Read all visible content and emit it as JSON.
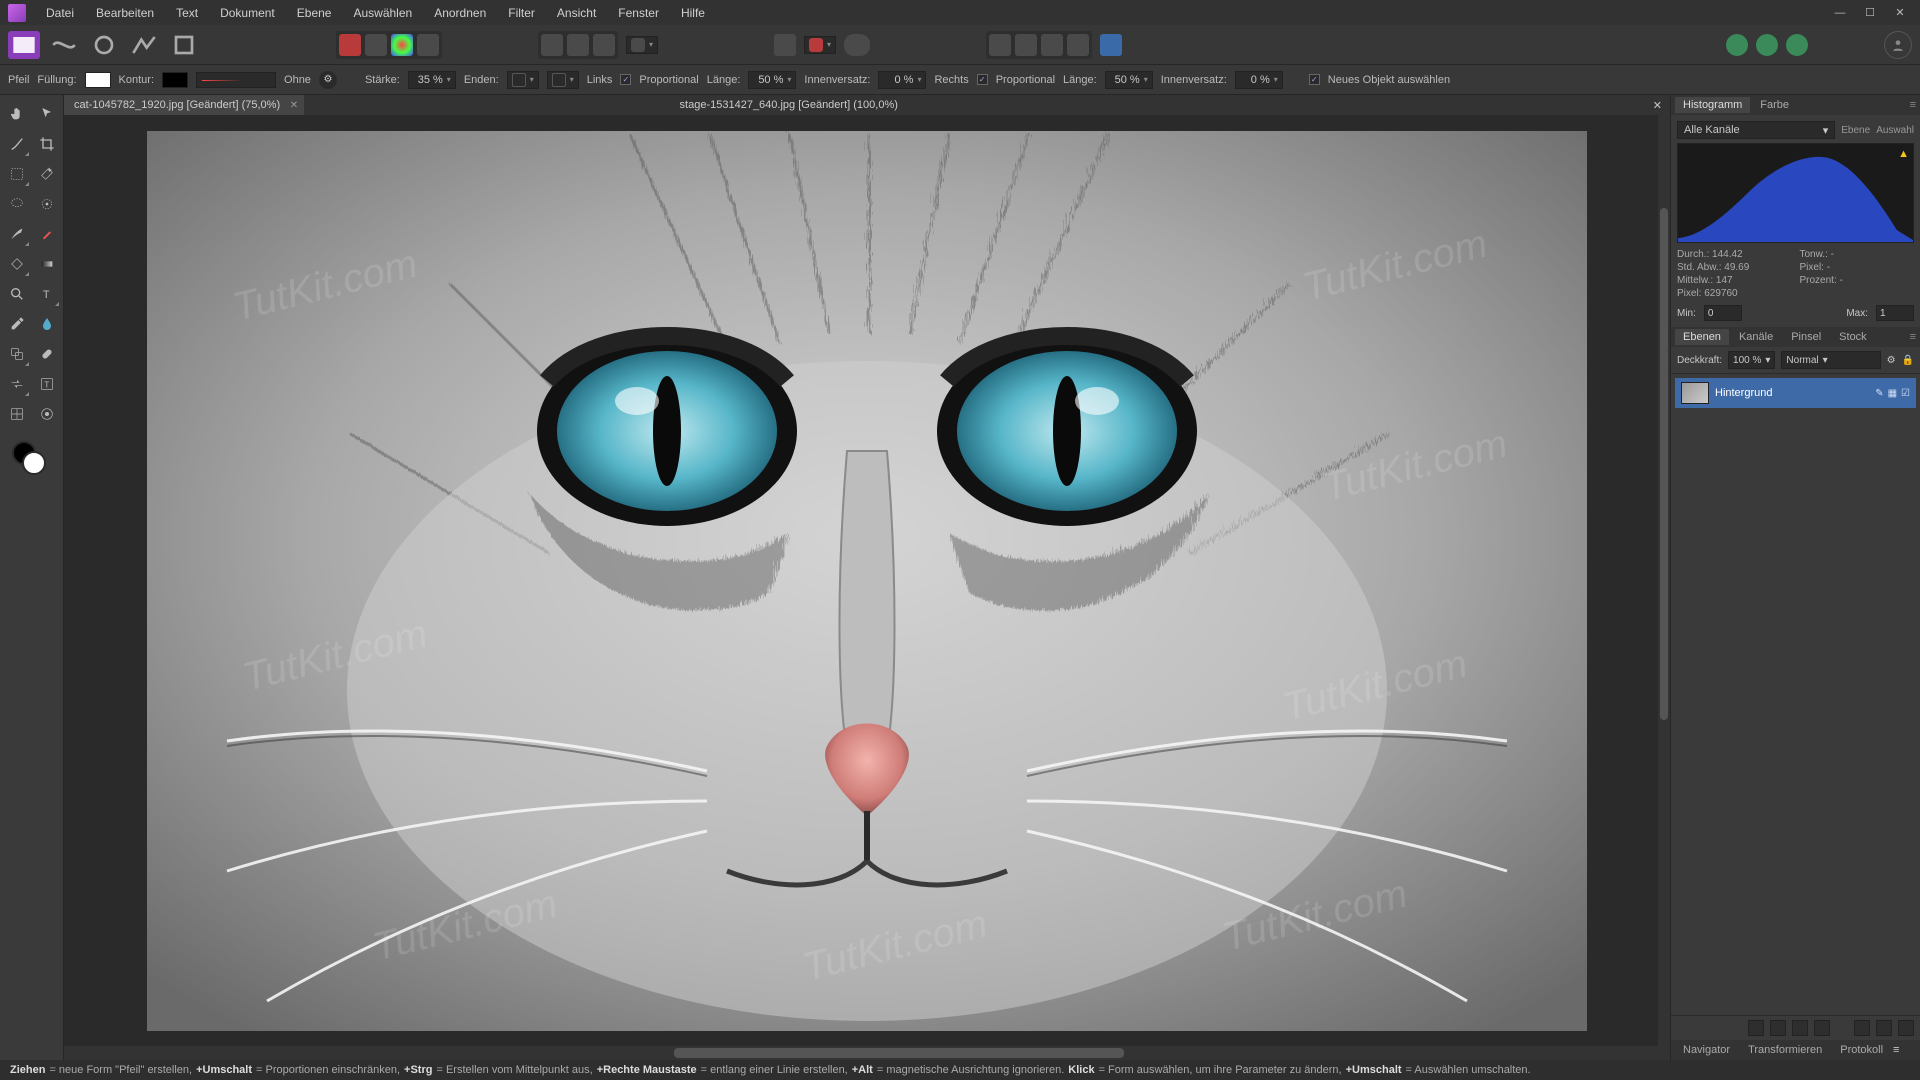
{
  "menu": {
    "items": [
      "Datei",
      "Bearbeiten",
      "Text",
      "Dokument",
      "Ebene",
      "Auswählen",
      "Anordnen",
      "Filter",
      "Ansicht",
      "Fenster",
      "Hilfe"
    ]
  },
  "context": {
    "tool": "Pfeil",
    "fill_label": "Füllung:",
    "stroke_label": "Kontur:",
    "stroke_style": "Ohne",
    "strength_label": "Stärke:",
    "strength": "35 %",
    "ends_label": "Enden:",
    "left_label": "Links",
    "right_label": "Rechts",
    "prop_label": "Proportional",
    "length_label": "Länge:",
    "length_l": "50 %",
    "inset_label": "Innenversatz:",
    "inset_l": "0 %",
    "length_r": "50 %",
    "inset_r": "0 %",
    "newobj": "Neues Objekt auswählen"
  },
  "tabs": {
    "t0": {
      "name": "cat-1045782_1920.jpg",
      "state": "[Geändert]",
      "zoom": "(75,0%)"
    },
    "t1": {
      "name": "stage-1531427_640.jpg",
      "state": "[Geändert]",
      "zoom": "(100,0%)"
    }
  },
  "watermark": "TutKit.com",
  "panel": {
    "histogram_tabs": [
      "Histogramm",
      "Farbe"
    ],
    "channels": "Alle Kanäle",
    "scope": [
      "Ebene",
      "Auswahl"
    ],
    "stats": {
      "durch": "Durch.: 144.42",
      "tonw": "Tonw.: -",
      "stdabw": "Std. Abw.: 49.69",
      "pixelp": "Pixel: -",
      "mittelw": "Mittelw.: 147",
      "prozent": "Prozent: -",
      "pixel": "Pixel: 629760"
    },
    "min_label": "Min:",
    "min": "0",
    "max_label": "Max:",
    "max": "1",
    "layer_tabs": [
      "Ebenen",
      "Kanäle",
      "Pinsel",
      "Stock"
    ],
    "opacity_label": "Deckkraft:",
    "opacity": "100 %",
    "blend": "Normal",
    "layer_name": "Hintergrund",
    "bottom_tabs": [
      "Navigator",
      "Transformieren",
      "Protokoll"
    ]
  },
  "hints": {
    "ziehen": "Ziehen",
    "ziehen_t": " = neue Form \"Pfeil\" erstellen, ",
    "umsch": "+Umschalt",
    "umsch_t": " = Proportionen einschränken, ",
    "strg": "+Strg",
    "strg_t": " = Erstellen vom Mittelpunkt aus, ",
    "rmb": "+Rechte Maustaste",
    "rmb_t": " = entlang einer Linie erstellen, ",
    "alt": "+Alt",
    "alt_t": " = magnetische Ausrichtung ignorieren. ",
    "klick": "Klick",
    "klick_t": " = Form auswählen, um ihre Parameter zu ändern, ",
    "umsch2": "+Umschalt",
    "umsch2_t": " = Auswählen umschalten."
  }
}
